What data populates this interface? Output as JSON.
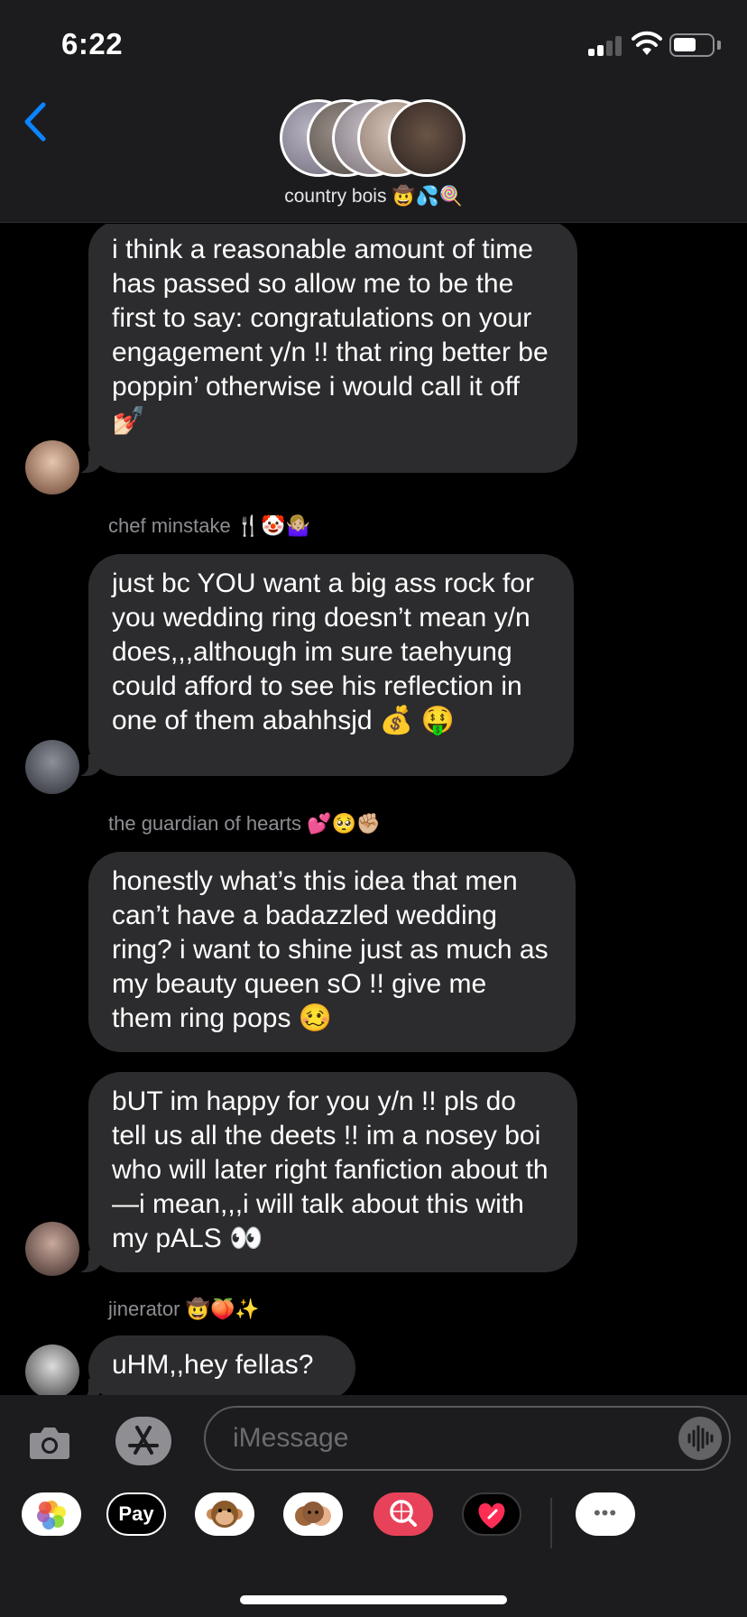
{
  "status_bar": {
    "time": "6:22"
  },
  "conversation": {
    "title": "country bois 🤠💦🍭"
  },
  "messages": [
    {
      "text": "i think a reasonable amount of time has passed so allow me to be the first to say: congratulations on your engagement y/n !! that ring better be poppin’ otherwise i would call it off 💅🏻"
    },
    {
      "sender": "chef minstake 🍴🤡🤷🏼‍♀️",
      "text": "just bc YOU want a big ass rock for you wedding ring doesn’t mean y/n does,,,although im sure taehyung could afford to see his reflection in one of them abahhsjd 💰 🤑"
    },
    {
      "sender": "the guardian of hearts 💕🥺✊🏼",
      "text": "honestly what’s this idea that men can’t have a badazzled wedding ring? i want to shine just as much as my beauty queen sO !! give me them ring pops 🥴"
    },
    {
      "text": "bUT im happy for you y/n !! pls do tell us all the deets !! im a nosey boi who will later right fanfiction about th—i mean,,,i will talk about this with my pALS 👀"
    },
    {
      "sender": "jinerator 🤠🍑✨",
      "text": "uHM,,hey fellas?"
    }
  ],
  "compose": {
    "placeholder": "iMessage"
  },
  "app_drawer": {
    "apple_pay_label": " Pay",
    "more_label": "•••"
  },
  "colors": {
    "accent": "#0a84ff",
    "bubble": "#2c2c2e",
    "bar": "#1c1c1e"
  }
}
